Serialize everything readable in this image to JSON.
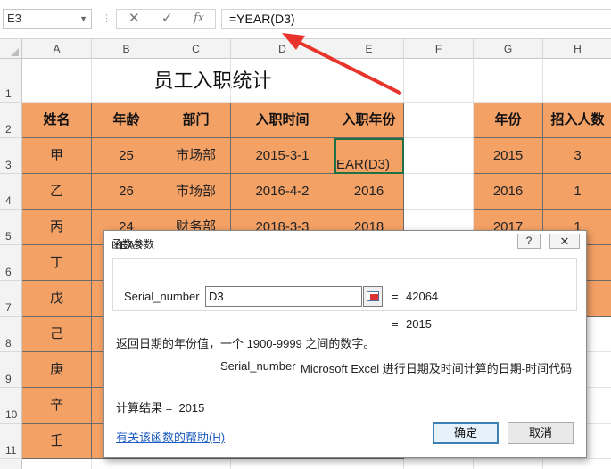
{
  "formula_bar": {
    "name_box": "E3",
    "cancel_icon": "✕",
    "enter_icon": "✓",
    "fx_label": "fx",
    "formula": "=YEAR(D3)"
  },
  "columns": [
    "A",
    "B",
    "C",
    "D",
    "E",
    "F",
    "G",
    "H"
  ],
  "rows": [
    "1",
    "2",
    "3",
    "4",
    "5",
    "6",
    "7",
    "8",
    "9",
    "10",
    "11"
  ],
  "sheet": {
    "title": "员工入职统计",
    "headers": [
      "姓名",
      "年龄",
      "部门",
      "入职时间",
      "入职年份"
    ],
    "data": [
      [
        "甲",
        "25",
        "市场部",
        "2015-3-1",
        "EAR(D3)"
      ],
      [
        "乙",
        "26",
        "市场部",
        "2016-4-2",
        "2016"
      ],
      [
        "丙",
        "24",
        "财务部",
        "2018-3-3",
        "2018"
      ],
      [
        "丁",
        "",
        "",
        "",
        ""
      ],
      [
        "戊",
        "",
        "",
        "",
        ""
      ],
      [
        "己",
        "",
        "",
        "",
        ""
      ],
      [
        "庚",
        "",
        "",
        "",
        ""
      ],
      [
        "辛",
        "",
        "",
        "",
        ""
      ],
      [
        "壬",
        "",
        "",
        "",
        ""
      ]
    ],
    "summary_headers": [
      "年份",
      "招入人数"
    ],
    "summary": [
      [
        "2015",
        "3"
      ],
      [
        "2016",
        "1"
      ],
      [
        "2017",
        "1"
      ]
    ]
  },
  "dialog": {
    "title": "函数参数",
    "help_glyph": "?",
    "close_glyph": "✕",
    "function_name": "YEAR",
    "arg_label": "Serial_number",
    "arg_value": "D3",
    "arg_eq": "=",
    "arg_result": "42064",
    "func_eq": "=",
    "func_result": "2015",
    "description": "返回日期的年份值，一个 1900-9999 之间的数字。",
    "arg_desc_name": "Serial_number",
    "arg_desc_text": "Microsoft Excel 进行日期及时间计算的日期-时间代码",
    "result_label": "计算结果 =",
    "result_value": "2015",
    "help_link": "有关该函数的帮助(H)",
    "ok": "确定",
    "cancel": "取消"
  },
  "colors": {
    "table_fill": "#f4a166",
    "arrow_red": "#e8342a",
    "arrow_blue": "#2f8fe0",
    "selection": "#1e7145"
  }
}
